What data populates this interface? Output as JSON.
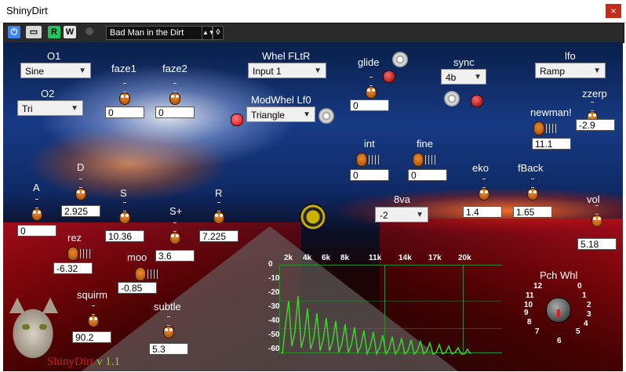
{
  "window": {
    "title": "ShinyDirt",
    "close_glyph": "×"
  },
  "toolbar": {
    "power_glyph": "⏻",
    "compare_glyph": "▭",
    "read_label": "R",
    "write_label": "W",
    "preset_name": "Bad Man in the Dirt",
    "preset_arrows": "▲▼",
    "colors": {
      "power": "#3b82f6",
      "read": "#22c55e",
      "write": "#e5e5e5"
    }
  },
  "osc": {
    "o1_label": "O1",
    "o1_value": "Sine",
    "o2_label": "O2",
    "o2_value": "Tri"
  },
  "faze1": {
    "label": "faze1",
    "value": "0"
  },
  "faze2": {
    "label": "faze2",
    "value": "0"
  },
  "wheel": {
    "whel_fltr_label": "Whel FLtR",
    "whel_fltr_value": "Input 1",
    "modwhel_label": "ModWhel Lf0",
    "modwhel_value": "Triangle"
  },
  "glide": {
    "label": "glide",
    "value": "0"
  },
  "sync": {
    "label": "sync",
    "value": "4b"
  },
  "lfo": {
    "label": "lfo",
    "value": "Ramp"
  },
  "zzerp": {
    "label": "zzerp",
    "value": "-2.9"
  },
  "newman": {
    "label": "newman!",
    "value": "11.1"
  },
  "int": {
    "label": "int",
    "value": "0"
  },
  "fine": {
    "label": "fine",
    "value": "0"
  },
  "adsr": {
    "a_label": "A",
    "a_value": "0",
    "d_label": "D",
    "d_value": "2.925",
    "s_label": "S",
    "s_value": "10.36",
    "splus_label": "S+",
    "splus_value": "3.6",
    "r_label": "R",
    "r_value": "7.225"
  },
  "rez": {
    "label": "rez",
    "value": "-6.32"
  },
  "moo": {
    "label": "moo",
    "value": "-0.85"
  },
  "squirm": {
    "label": "squirm",
    "value": "90.2"
  },
  "subtle": {
    "label": "subtle",
    "value": "5.3"
  },
  "octave": {
    "label": "8va",
    "value": "-2"
  },
  "eko": {
    "label": "eko",
    "value": "1.4"
  },
  "fback": {
    "label": "fBack",
    "value": "1.65"
  },
  "vol": {
    "label": "vol",
    "value": "5.18"
  },
  "spectrum": {
    "freq_labels": [
      "2k",
      "4k",
      "6k",
      "8k",
      "11k",
      "14k",
      "17k",
      "20k"
    ],
    "db_labels": [
      "0",
      "-10",
      "-20",
      "-30",
      "-40",
      "-50",
      "-60"
    ],
    "line_color": "#39d629"
  },
  "pitch_wheel": {
    "label": "Pch Whl",
    "numbers": [
      "0",
      "1",
      "2",
      "3",
      "4",
      "5",
      "6",
      "7",
      "8",
      "9",
      "10",
      "11",
      "12"
    ]
  },
  "brand": {
    "name": "ShinyDirt",
    "version": "v 1.1",
    "name_color": "#d01c1c",
    "version_color": "#9acd32"
  }
}
